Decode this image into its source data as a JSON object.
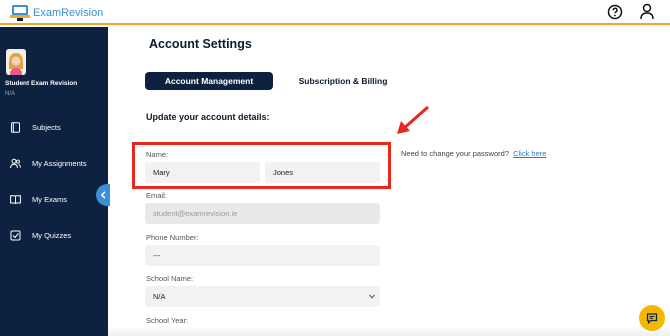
{
  "app": {
    "logo_text": "ExamRevision"
  },
  "header": {
    "help_icon": "help-circle-icon",
    "user_icon": "user-icon"
  },
  "sidebar": {
    "user_name": "Student Exam Revision",
    "user_sub": "N/A",
    "items": [
      {
        "label": "Subjects",
        "icon": "book-icon"
      },
      {
        "label": "My Assignments",
        "icon": "users-icon"
      },
      {
        "label": "My Exams",
        "icon": "open-book-icon"
      },
      {
        "label": "My Quizzes",
        "icon": "check-square-icon"
      }
    ]
  },
  "page": {
    "title": "Account Settings",
    "tabs": [
      {
        "label": "Account Management",
        "active": true
      },
      {
        "label": "Subscription & Billing",
        "active": false
      }
    ],
    "section_title": "Update your account details:"
  },
  "form": {
    "name_label": "Name:",
    "first_name": "Mary",
    "last_name": "Jones",
    "email_label": "Email:",
    "email_placeholder": "student@examrevision.ie",
    "phone_label": "Phone Number:",
    "phone_value": "---",
    "school_label": "School Name:",
    "school_value": "N/A",
    "year_label": "School Year:"
  },
  "password": {
    "text": "Need to change your password?",
    "link": "Click here"
  },
  "colors": {
    "sidebar_bg": "#0d2240",
    "accent_blue": "#3a8fd6",
    "highlight_red": "#e8281c",
    "chat_yellow": "#f5b800"
  }
}
